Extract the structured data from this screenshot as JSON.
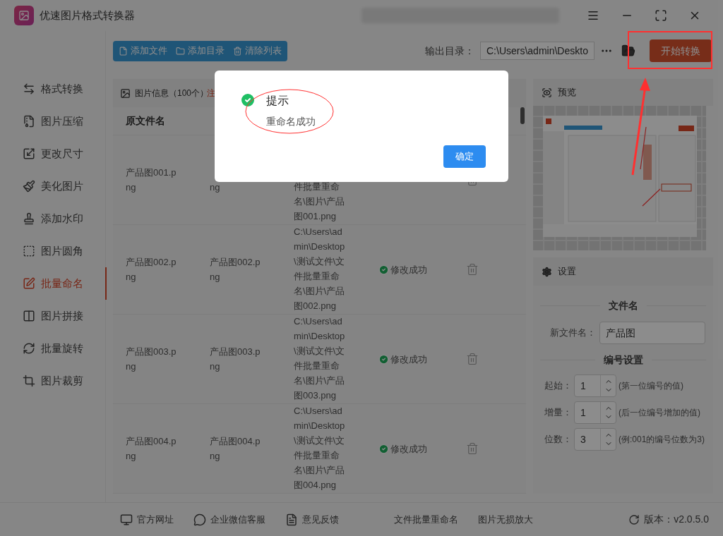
{
  "window": {
    "title": "优速图片格式转换器"
  },
  "toolbar": {
    "buttons": [
      "添加文件",
      "添加目录",
      "清除列表"
    ],
    "output_label": "输出目录：",
    "output_path": "C:\\Users\\admin\\Deskto",
    "start_button": "开始转换"
  },
  "sidebar": {
    "items": [
      {
        "label": "格式转换",
        "selected": false
      },
      {
        "label": "图片压缩",
        "selected": false
      },
      {
        "label": "更改尺寸",
        "selected": false
      },
      {
        "label": "美化图片",
        "selected": false
      },
      {
        "label": "添加水印",
        "selected": false
      },
      {
        "label": "图片圆角",
        "selected": false
      },
      {
        "label": "批量命名",
        "selected": true
      },
      {
        "label": "图片拼接",
        "selected": false
      },
      {
        "label": "批量旋转",
        "selected": false
      },
      {
        "label": "图片裁剪",
        "selected": false
      }
    ]
  },
  "file_list": {
    "title": "图片信息（100个）",
    "notice": "注",
    "columns": [
      "原文件名"
    ],
    "rows": [
      {
        "original": "产品图001.png",
        "renamed": "ng",
        "path": "件批量重命名\\图片\\产品图001.png"
      },
      {
        "original": "产品图002.png",
        "renamed": "产品图002.png",
        "path": "C:\\Users\\admin\\Desktop\\测试文件\\文件批量重命名\\图片\\产品图002.png",
        "status": "修改成功"
      },
      {
        "original": "产品图003.png",
        "renamed": "产品图003.png",
        "path": "C:\\Users\\admin\\Desktop\\测试文件\\文件批量重命名\\图片\\产品图003.png",
        "status": "修改成功"
      },
      {
        "original": "产品图004.png",
        "renamed": "产品图004.png",
        "path": "C:\\Users\\admin\\Desktop\\测试文件\\文件批量重命名\\图片\\产品图004.png",
        "status": "修改成功"
      }
    ]
  },
  "preview": {
    "title": "预览"
  },
  "settings": {
    "title": "设置",
    "filename_heading": "文件名",
    "filename_label": "新文件名：",
    "filename_value": "产品图",
    "numbering_heading": "编号设置",
    "fields": [
      {
        "label": "起始：",
        "value": "1",
        "hint": "(第一位编号的值)"
      },
      {
        "label": "增量：",
        "value": "1",
        "hint": "(后一位编号增加的值)"
      },
      {
        "label": "位数：",
        "value": "3",
        "hint": "(例:001的编号位数为3)"
      }
    ]
  },
  "footer": {
    "links": [
      "官方网址",
      "企业微信客服",
      "意见反馈"
    ],
    "center_links": [
      "文件批量重命名",
      "图片无损放大"
    ],
    "version": "版本：v2.0.5.0"
  },
  "dialog": {
    "title": "提示",
    "message": "重命名成功",
    "button": "确定"
  }
}
